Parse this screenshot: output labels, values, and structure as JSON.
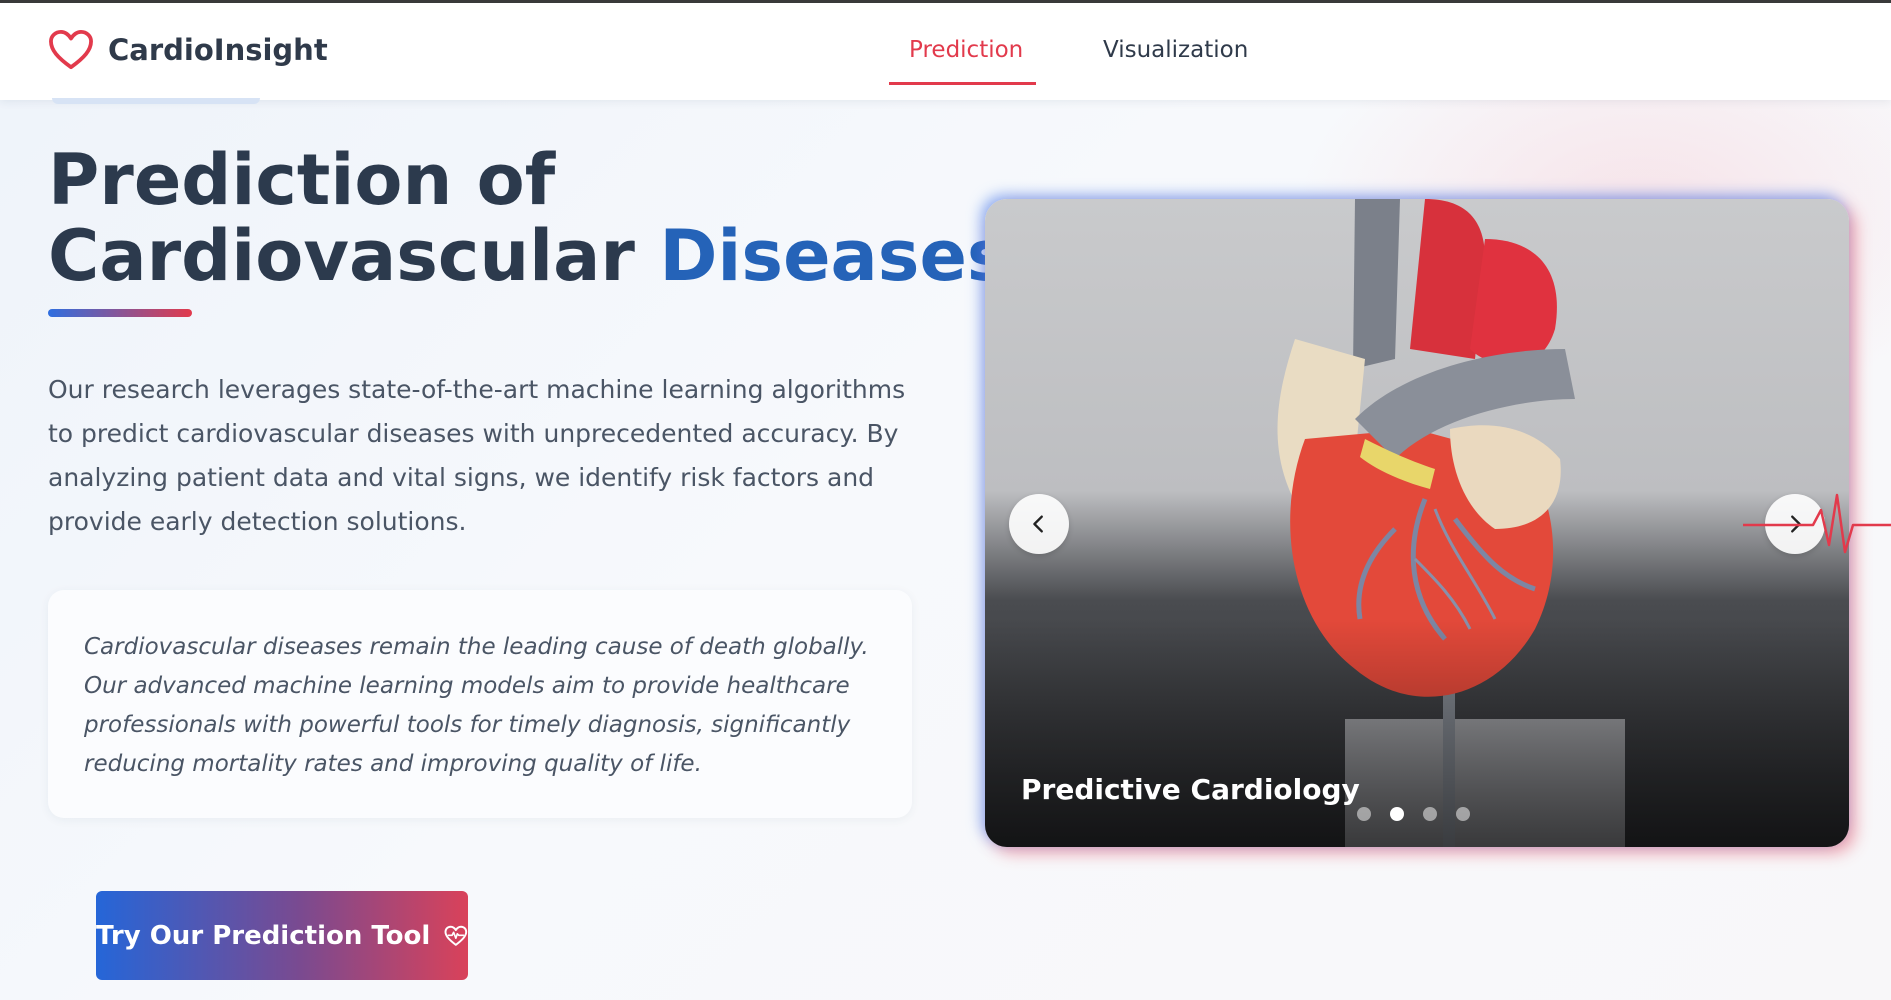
{
  "nav": {
    "logo_text": "CardioInsight",
    "links": [
      {
        "label": "Prediction",
        "active": true
      },
      {
        "label": "Visualization",
        "active": false
      }
    ]
  },
  "hero": {
    "title_line1": "Prediction of",
    "title_line2_a": "Cardiovascular",
    "title_line2_b": "Diseases",
    "description": "Our research leverages state-of-the-art machine learning algorithms to predict cardiovascular diseases with unprecedented accuracy. By analyzing patient data and vital signs, we identify risk factors and provide early detection solutions.",
    "quote": "Cardiovascular diseases remain the leading cause of death globally. Our advanced machine learning models aim to provide healthcare professionals with powerful tools for timely diagnosis, significantly reducing mortality rates and improving quality of life.",
    "cta_label": "Try Our Prediction Tool"
  },
  "carousel": {
    "caption": "Predictive Cardiology",
    "slide_count": 4,
    "active_index": 1
  },
  "colors": {
    "accent_red": "#e23a4c",
    "accent_blue": "#2563b8",
    "text_dark": "#2c3a4d"
  },
  "icons": {
    "logo": "heart-outline-icon",
    "cta": "heart-pulse-icon",
    "prev": "chevron-left-icon",
    "next": "chevron-right-icon"
  }
}
